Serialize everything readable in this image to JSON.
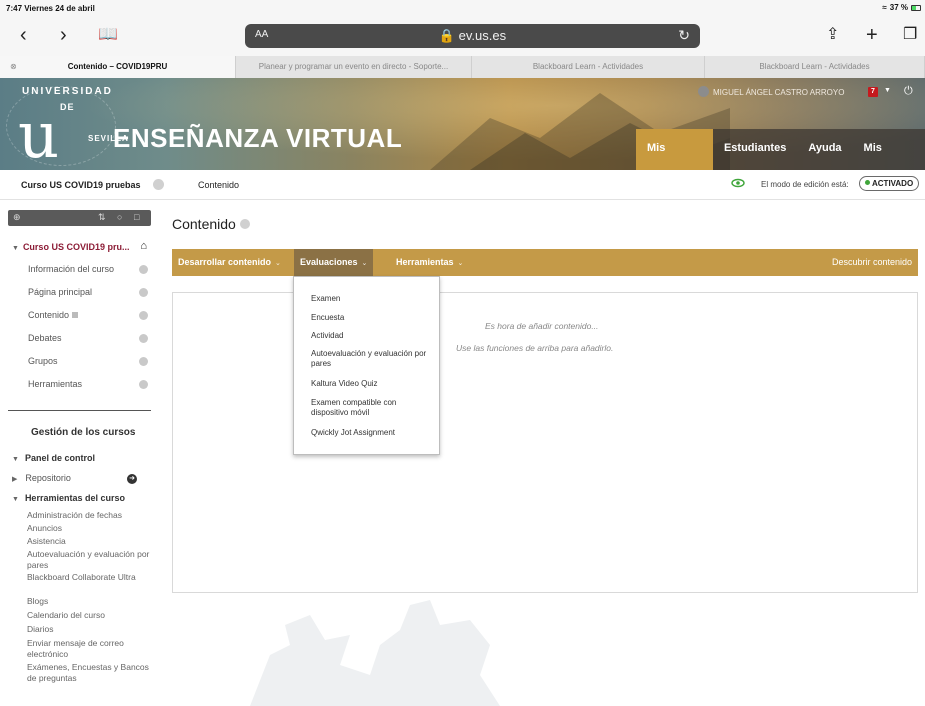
{
  "status_bar": {
    "time_date": "7:47  Viernes 24 de abril",
    "battery": "37 %"
  },
  "browser": {
    "aa": "AA",
    "url": "ev.us.es",
    "tabs": [
      {
        "label": "Contenido – COVID19PRU",
        "active": true
      },
      {
        "label": "Planear y programar un evento en directo - Soporte...",
        "active": false
      },
      {
        "label": "Blackboard Learn - Actividades",
        "active": false
      },
      {
        "label": "Blackboard Learn - Actividades",
        "active": false
      }
    ]
  },
  "banner": {
    "logo_letter": "u",
    "logo_text_top": "UNIVERSIDAD",
    "logo_text_de": "DE",
    "logo_text_bottom": "SEVILLA",
    "title": "ENSEÑANZA VIRTUAL",
    "user": "MIGUEL ÁNGEL CASTRO ARROYO",
    "notifications": "7",
    "nav": [
      {
        "label": "Mis Cursos",
        "active": true
      },
      {
        "label": "Estudiantes",
        "active": false
      },
      {
        "label": "Ayuda",
        "active": false
      },
      {
        "label": "Mis Redes",
        "active": false
      }
    ]
  },
  "breadcrumb": {
    "course": "Curso US COVID19 pruebas",
    "page": "Contenido",
    "edit_mode_label": "El modo de edición está:",
    "edit_mode_value": "ACTIVADO"
  },
  "sidebar": {
    "course_title": "Curso US COVID19 pru...",
    "items": [
      "Información del curso",
      "Página principal",
      "Contenido",
      "Debates",
      "Grupos",
      "Herramientas"
    ],
    "management_title": "Gestión de los cursos",
    "panel_title": "Panel de control",
    "repositorio": "Repositorio",
    "tools_title": "Herramientas del curso",
    "tools": [
      "Administración de fechas",
      "Anuncios",
      "Asistencia",
      "Autoevaluación y evaluación por pares",
      "Blackboard Collaborate Ultra",
      "Blogs",
      "Calendario del curso",
      "Diarios",
      "Enviar mensaje de correo electrónico",
      "Exámenes, Encuestas y Bancos de preguntas"
    ]
  },
  "main": {
    "title": "Contenido",
    "actions": [
      {
        "label": "Desarrollar contenido",
        "active": false
      },
      {
        "label": "Evaluaciones",
        "active": true
      },
      {
        "label": "Herramientas",
        "active": false
      }
    ],
    "discover": "Descubrir contenido",
    "empty_line1": "Es hora de añadir contenido...",
    "empty_line2": "Use las funciones de arriba para añadirlo.",
    "dropdown": [
      "Examen",
      "Encuesta",
      "Actividad",
      "Autoevaluación y evaluación por pares",
      "Kaltura Video Quiz",
      "Examen compatible con dispositivo móvil",
      "Qwickly Jot Assignment"
    ]
  },
  "colors": {
    "accent": "#c49a48",
    "active_tab": "#8b7145",
    "course_title": "#8c1c36"
  }
}
